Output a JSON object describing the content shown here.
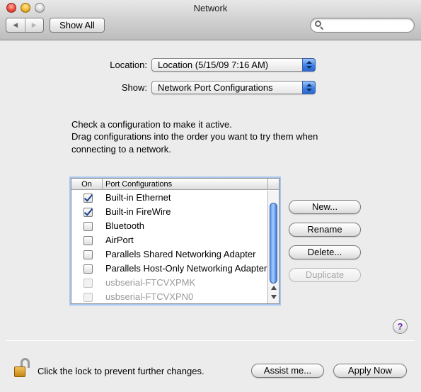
{
  "window": {
    "title": "Network"
  },
  "toolbar": {
    "back_icon": "back-arrow-icon",
    "forward_icon": "forward-arrow-icon",
    "show_all": "Show All",
    "search": {
      "value": "",
      "placeholder": ""
    }
  },
  "location": {
    "label": "Location:",
    "value": "Location (5/15/09 7:16 AM)"
  },
  "show": {
    "label": "Show:",
    "value": "Network Port Configurations"
  },
  "instructions": {
    "line1": "Check a configuration to make it active.",
    "line2": "Drag configurations into the order you want to try them when",
    "line3": "connecting to a network."
  },
  "table": {
    "headers": {
      "on": "On",
      "port": "Port Configurations"
    },
    "rows": [
      {
        "name": "Built-in Ethernet",
        "checked": true,
        "enabled": true
      },
      {
        "name": "Built-in FireWire",
        "checked": true,
        "enabled": true
      },
      {
        "name": "Bluetooth",
        "checked": false,
        "enabled": true
      },
      {
        "name": "AirPort",
        "checked": false,
        "enabled": true
      },
      {
        "name": "Parallels Shared Networking Adapter",
        "checked": false,
        "enabled": true
      },
      {
        "name": "Parallels Host-Only Networking Adapter",
        "checked": false,
        "enabled": true
      },
      {
        "name": "usbserial-FTCVXPMK",
        "checked": false,
        "enabled": false
      },
      {
        "name": "usbserial-FTCVXPN0",
        "checked": false,
        "enabled": false
      }
    ]
  },
  "buttons": {
    "new": "New...",
    "rename": "Rename",
    "delete": "Delete...",
    "duplicate": "Duplicate"
  },
  "help": {
    "label": "?"
  },
  "footer": {
    "lock_text": "Click the lock to prevent further changes.",
    "assist": "Assist me...",
    "apply": "Apply Now"
  },
  "colors": {
    "accent": "#3d7fe3",
    "selection_ring": "#a8c6ef"
  }
}
